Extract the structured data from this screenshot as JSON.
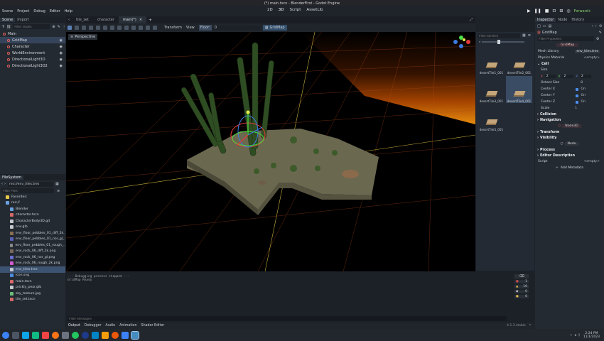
{
  "window": {
    "title": "(*) main.tscn - BlenderFirst - Godot Engine"
  },
  "menu": [
    "Scene",
    "Project",
    "Debug",
    "Editor",
    "Help"
  ],
  "workspaces": [
    "2D",
    "3D",
    "Script",
    "AssetLib"
  ],
  "renderer": "Forward+",
  "scene_dock": {
    "tabs": [
      "Scene",
      "Import"
    ],
    "filter_placeholder": "Filter Nodes",
    "nodes": [
      {
        "label": "Main",
        "color": "#e0605a",
        "depth": 0
      },
      {
        "label": "GridMap",
        "color": "#e0605a",
        "depth": 1,
        "selected": true
      },
      {
        "label": "Character",
        "color": "#e0605a",
        "depth": 1
      },
      {
        "label": "WorldEnvironment",
        "color": "#e0605a",
        "depth": 1
      },
      {
        "label": "DirectionalLight3D",
        "color": "#e0605a",
        "depth": 1
      },
      {
        "label": "DirectionalLight3D2",
        "color": "#e0605a",
        "depth": 1
      }
    ]
  },
  "filesystem": {
    "title": "FileSystem",
    "path": "res://env_tiles.tres",
    "filter_placeholder": "Filter Files",
    "items": [
      {
        "label": "Favorites:",
        "color": "#e8c84a",
        "indent": 0
      },
      {
        "label": "res://",
        "color": "#6aa2e0",
        "indent": 0
      },
      {
        "label": "Blender",
        "color": "#6aa2e0",
        "indent": 1
      },
      {
        "label": "character.tscn",
        "color": "#d86a6a",
        "indent": 1
      },
      {
        "label": "CharacterBody3D.gd",
        "color": "#c6c9ce",
        "indent": 1
      },
      {
        "label": "env.glb",
        "color": "#c6c9ce",
        "indent": 1
      },
      {
        "label": "env_floor_pebbles_01_diff_2k.",
        "color": "#8c6f52",
        "indent": 1
      },
      {
        "label": "env_floor_pebbles_01_nor_gl_",
        "color": "#5a62b8",
        "indent": 1
      },
      {
        "label": "env_floor_pebbles_01_rough_..",
        "color": "#8a8a8a",
        "indent": 1
      },
      {
        "label": "env_rock_06_diff_2k.png",
        "color": "#7a6a5a",
        "indent": 1
      },
      {
        "label": "env_rock_06_nor_gl.png",
        "color": "#6b6fd0",
        "indent": 1
      },
      {
        "label": "env_rock_06_rough_2k.png",
        "color": "#d65cd1",
        "indent": 1
      },
      {
        "label": "env_tiles.tres",
        "color": "#c6c9ce",
        "indent": 1,
        "selected": true
      },
      {
        "label": "icon.svg",
        "color": "#4d8de0",
        "indent": 1
      },
      {
        "label": "main.tscn",
        "color": "#d86a6a",
        "indent": 1
      },
      {
        "label": "prickly_pear.glb",
        "color": "#c6c9ce",
        "indent": 1
      },
      {
        "label": "sky_texture.jpg",
        "color": "#6ac07a",
        "indent": 1
      },
      {
        "label": "tile_set.tscn",
        "color": "#d86a6a",
        "indent": 1
      }
    ]
  },
  "doc_tabs": [
    "tile_set",
    "character",
    "main(*)"
  ],
  "vp_toolbar": {
    "transform": "Transform",
    "view": "View",
    "floor_label": "Floor:",
    "floor_value": "0",
    "gridmap": "GridMap"
  },
  "viewport": {
    "perspective_label": "Perspective"
  },
  "meshlib": {
    "filter_placeholder": "Filter Meshes",
    "items": [
      "desertTile1_001",
      "desertTile2_001",
      "desertTile3_001",
      "desertTile4_001",
      "desertTile5_001"
    ],
    "selected_index": 3
  },
  "inspector": {
    "tabs": [
      "Inspector",
      "Node",
      "History"
    ],
    "node_label": "GridMap",
    "filter_placeholder": "Filter Properties",
    "mesh_library_label": "Mesh Library",
    "mesh_library_value": "env_tiles.tres",
    "physics_material_label": "Physics Material",
    "physics_material_value": "<empty>",
    "section_cell": "Cell",
    "size_label": "Size",
    "size_x": "2",
    "size_y": "2",
    "size_z": "2",
    "octant_label": "Octant Size",
    "octant_value": "8",
    "center_x": "Center X",
    "center_y": "Center Y",
    "center_z": "Center Z",
    "on": "On",
    "scale_label": "Scale",
    "scale_value": "1",
    "section_collision": "Collision",
    "section_navigation": "Navigation",
    "section_transform": "Transform",
    "section_visibility": "Visibility",
    "node3d": "Node3D",
    "node": "Node",
    "section_process": "Process",
    "section_editor_desc": "Editor Description",
    "script_label": "Script",
    "script_value": "<empty>",
    "add_metadata": "Add Metadata"
  },
  "output": {
    "lines": [
      "--- Debugging process stopped ---",
      "GridMap Ready"
    ],
    "filter_placeholder": "Filter Messages",
    "tabs": [
      "Output",
      "Debugger",
      "Audio",
      "Animation",
      "Shader Editor"
    ],
    "version": "4.1.3.stable",
    "counts": [
      "1",
      "16",
      "0",
      "0"
    ]
  },
  "taskbar": {
    "time": "2:24 PM",
    "date": "11/1/2023"
  }
}
